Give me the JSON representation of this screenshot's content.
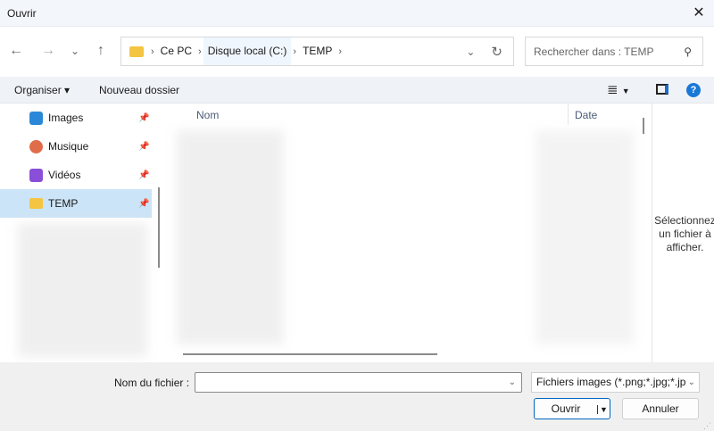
{
  "window": {
    "title": "Ouvrir"
  },
  "nav": {
    "back": "←",
    "forward": "→",
    "recent": "⌄",
    "up": "↑",
    "dropdown": "⌄",
    "refresh": "↻"
  },
  "address": {
    "crumbs": [
      "Ce PC",
      "Disque local (C:)",
      "TEMP"
    ],
    "separator": "›"
  },
  "search": {
    "placeholder": "Rechercher dans : TEMP"
  },
  "toolbar": {
    "organize": "Organiser ▾",
    "new_folder": "Nouveau dossier"
  },
  "sidebar": {
    "items": [
      {
        "label": "Images",
        "icon": "images-icon",
        "color": "#2b88d8"
      },
      {
        "label": "Musique",
        "icon": "music-icon",
        "color": "#e06c4a"
      },
      {
        "label": "Vidéos",
        "icon": "videos-icon",
        "color": "#8a4fd8"
      },
      {
        "label": "TEMP",
        "icon": "folder-icon",
        "color": "#f4c542",
        "selected": true
      }
    ]
  },
  "filelist": {
    "columns": [
      "Nom",
      "Date"
    ]
  },
  "preview": {
    "message": "Sélectionnez un fichier à afficher."
  },
  "footer": {
    "filename_label": "Nom du fichier :",
    "filename_value": "",
    "filetype": "Fichiers images (*.png;*.jpg;*.jp",
    "open": "Ouvrir",
    "cancel": "Annuler"
  },
  "colors": {
    "accent": "#0067c0",
    "selection": "#cce4f7"
  }
}
